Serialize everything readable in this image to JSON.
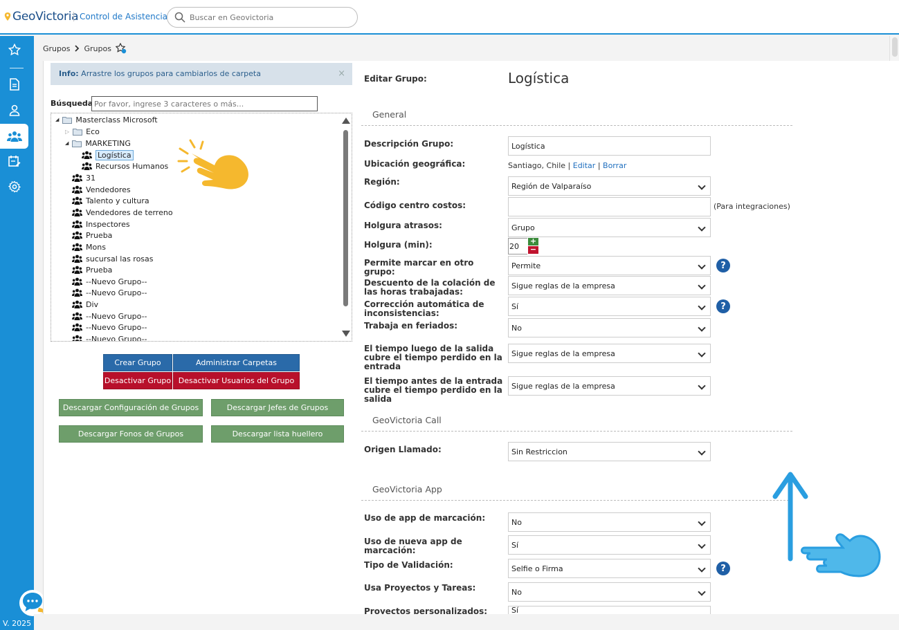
{
  "app": {
    "brand": "GeoVictoria",
    "module": "Control de Asistencia",
    "search_placeholder": "Buscar en Geovictoria",
    "version": "V. 2025"
  },
  "breadcrumb": [
    "Grupos",
    "Grupos"
  ],
  "left": {
    "info_label": "Info:",
    "info_text": " Arrastre los grupos para cambiarlos de carpeta",
    "search_label": "Búsqueda:",
    "search_placeholder": "Por favor, ingrese 3 caracteres o más...",
    "tree": [
      "Masterclass Microsoft",
      "Eco",
      "MARKETING",
      "Logística",
      "Recursos Humanos",
      "31",
      "Vendedores",
      "Talento y cultura",
      "Vendedores de terreno",
      "Inspectores",
      "Prueba",
      "Mons",
      "sucursal las rosas",
      "Prueba",
      "--Nuevo Grupo--",
      "--Nuevo Grupo--",
      "Div",
      "--Nuevo Grupo--",
      "--Nuevo Grupo--",
      "--Nuevo Grupo--"
    ],
    "buttons": {
      "crear": "Crear Grupo",
      "admin": "Administrar Carpetas",
      "desactivar": "Desactivar Grupo",
      "desactivar_usuarios": "Desactivar Usuarios del Grupo",
      "desc_config": "Descargar Configuración de Grupos",
      "desc_jefes": "Descargar Jefes de Grupos",
      "desc_fonos": "Descargar Fonos de Grupos",
      "desc_huellero": "Descargar lista huellero"
    }
  },
  "form": {
    "edit_label": "Editar Grupo:",
    "group_name": "Logística",
    "sections": {
      "general": "General",
      "call": "GeoVictoria Call",
      "app": "GeoVictoria App"
    },
    "labels": {
      "descripcion": "Descripción Grupo:",
      "ubicacion": "Ubicación geográfica:",
      "region": "Región:",
      "codigo": "Código centro costos:",
      "holgura_atrasos": "Holgura atrasos:",
      "holgura_min": "Holgura (min):",
      "permite_marcar": "Permite marcar en otro grupo:",
      "descuento": "Descuento de la colación de las horas trabajadas:",
      "correccion": "Corrección automática de inconsistencias:",
      "feriados": "Trabaja en feriados:",
      "tiempo_luego": "El tiempo luego de la salida cubre el tiempo perdido en la entrada",
      "tiempo_antes": "El tiempo antes de la entrada cubre el tiempo perdido en la salida",
      "origen": "Origen Llamado:",
      "uso_app": "Uso de app de marcación:",
      "uso_nueva_app": "Uso de nueva app de marcación:",
      "tipo_validacion": "Tipo de Validación:",
      "proyectos": "Usa Proyectos y Tareas:",
      "proyectos_pers": "Proyectos personalizados:"
    },
    "values": {
      "descripcion": "Logística",
      "ubicacion": "Santiago, Chile",
      "editar": "Editar",
      "borrar": "Borrar",
      "region": "Región de Valparaíso",
      "codigo": "",
      "codigo_hint": "(Para integraciones)",
      "holgura_atrasos": "Grupo",
      "holgura_min": "20",
      "permite_marcar": "Permite",
      "descuento": "Sigue reglas de la empresa",
      "correccion": "Sí",
      "feriados": "No",
      "tiempo_luego": "Sigue reglas de la empresa",
      "tiempo_antes": "Sigue reglas de la empresa",
      "origen": "Sin Restriccion",
      "uso_app": "No",
      "uso_nueva_app": "Sí",
      "tipo_validacion": "Selfie o Firma",
      "proyectos": "No",
      "proyectos_pers": "Sí"
    }
  },
  "colors": {
    "brand_blue": "#1a8fd6",
    "btn_blue": "#2a6aa9",
    "btn_red": "#b8102b",
    "btn_green": "#6e9e6b",
    "accent_yellow": "#f5b82e"
  }
}
